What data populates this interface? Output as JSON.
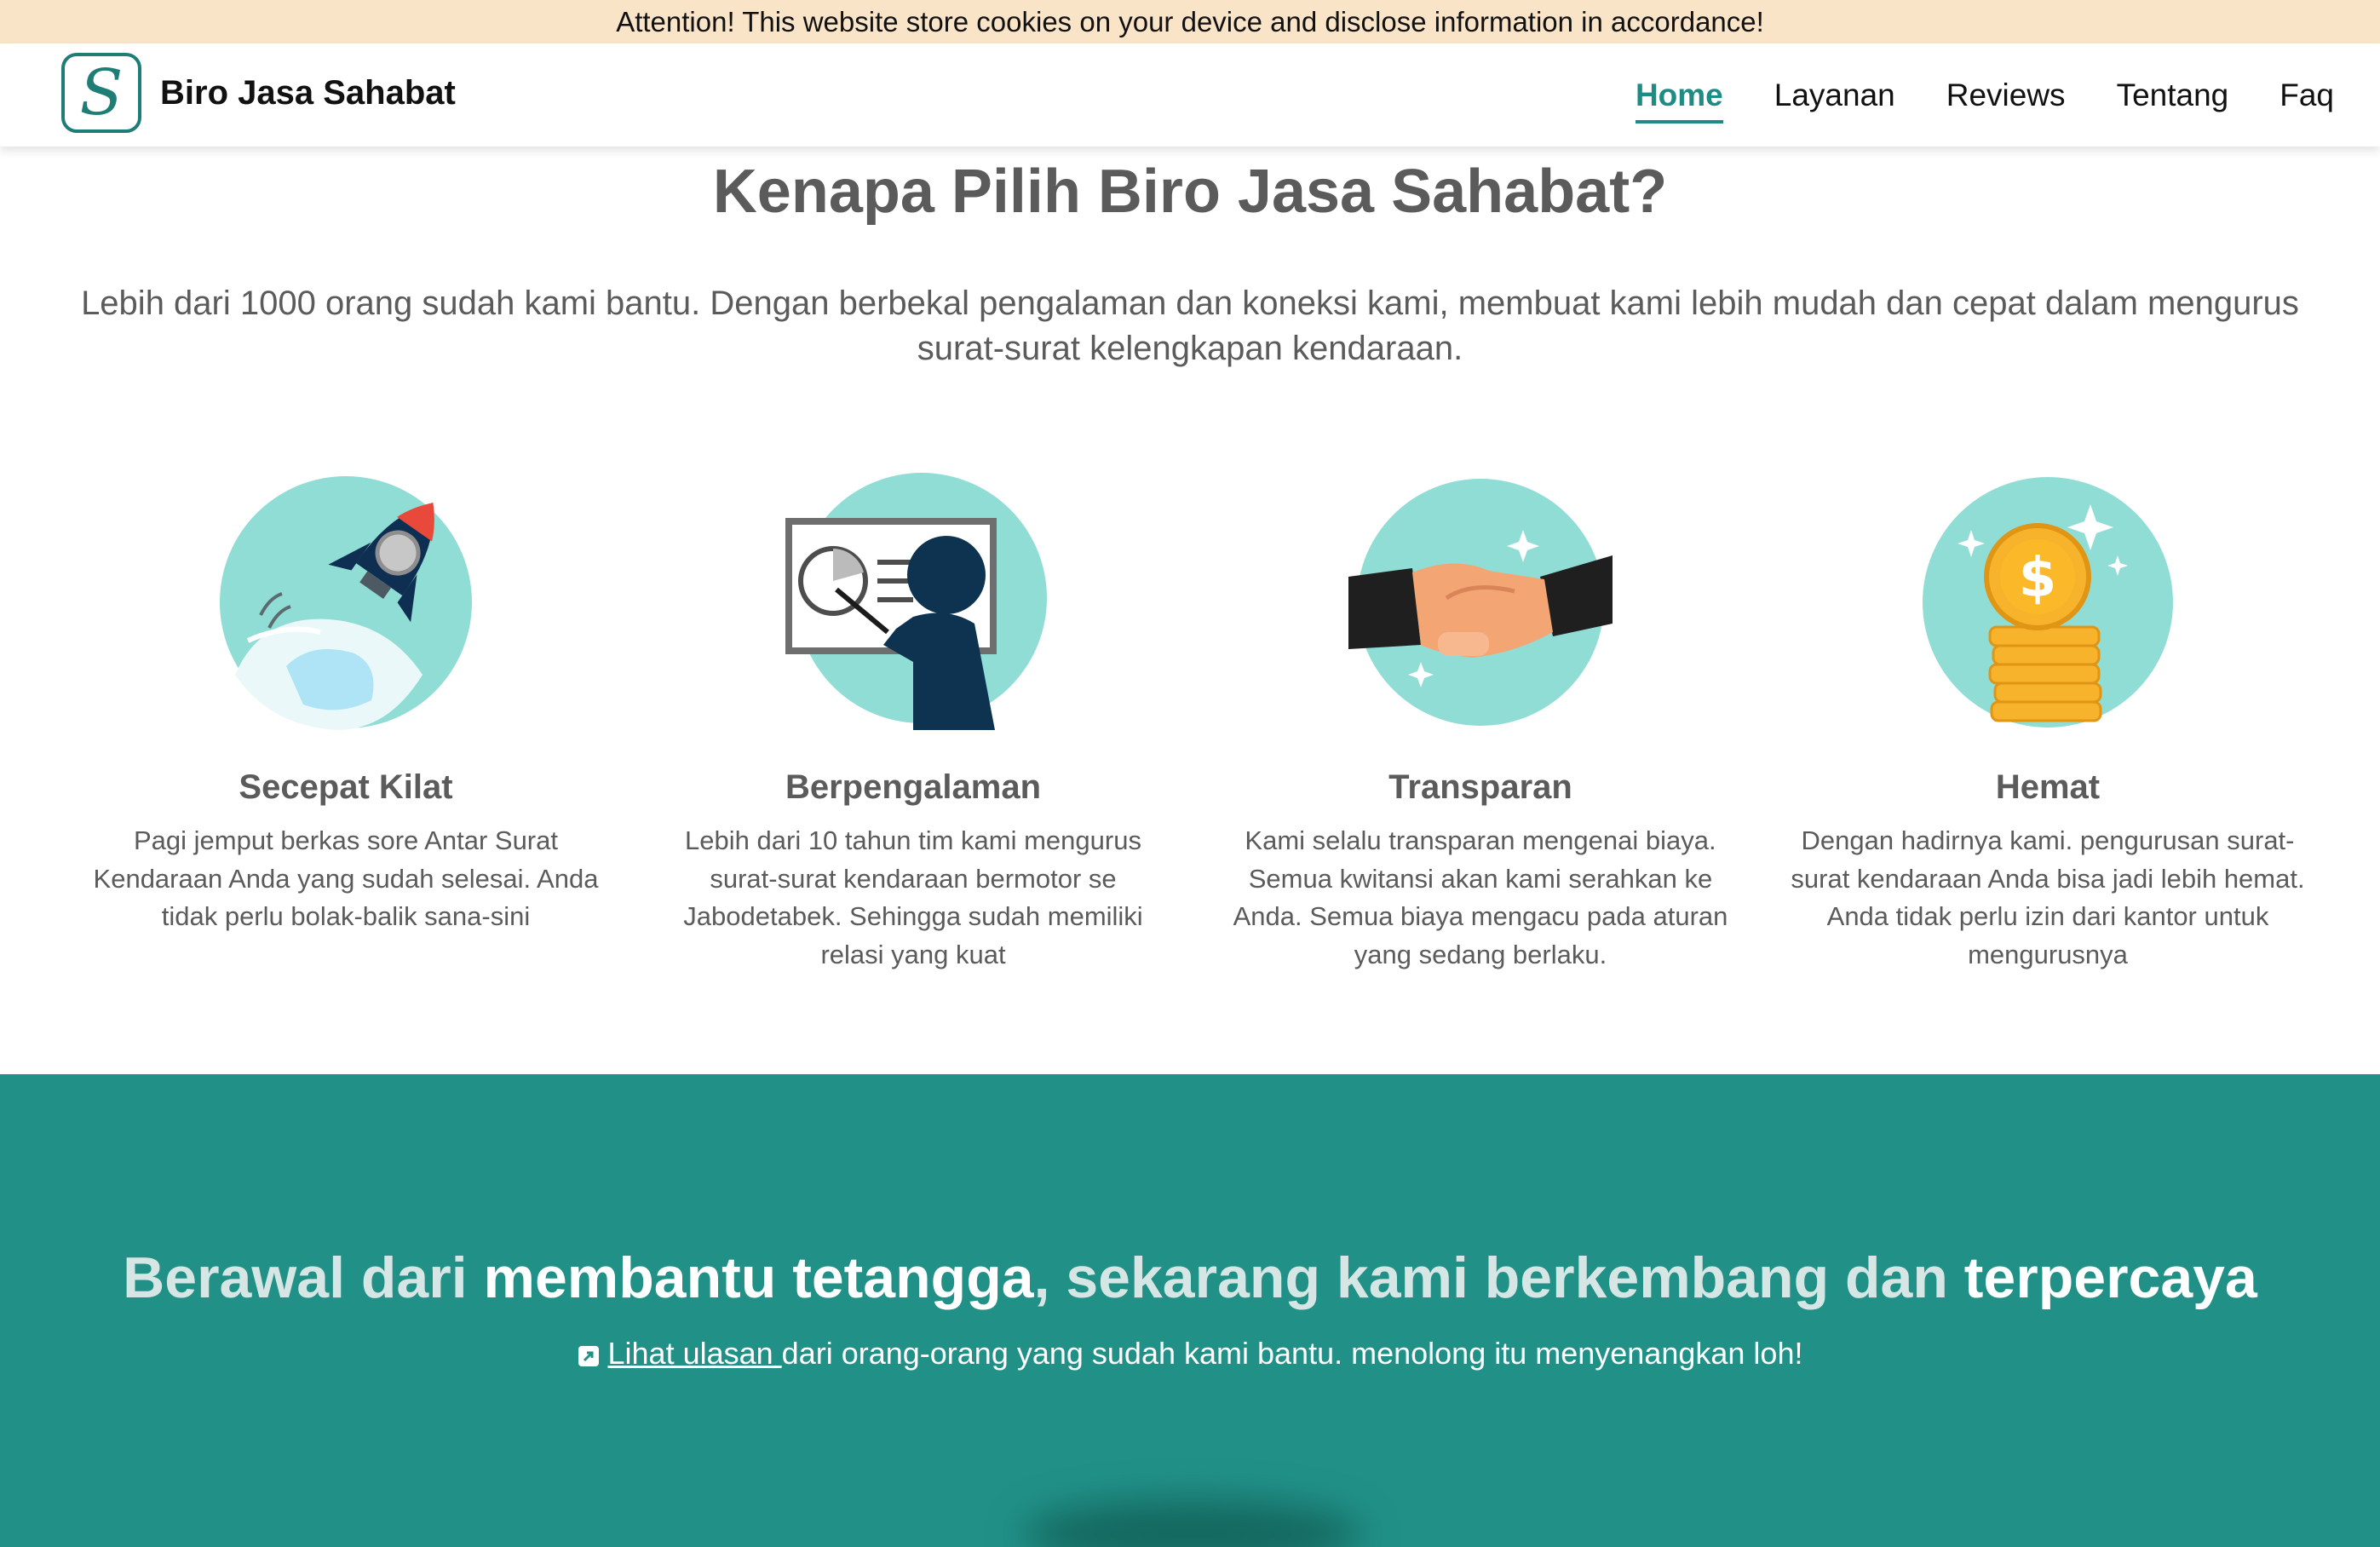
{
  "cookie_banner": {
    "text": "Attention! This website store cookies on your device and disclose information in accordance!"
  },
  "navbar": {
    "logo_letter": "S",
    "brand_name": "Biro Jasa Sahabat",
    "links": [
      {
        "label": "Home",
        "active": true
      },
      {
        "label": "Layanan",
        "active": false
      },
      {
        "label": "Reviews",
        "active": false
      },
      {
        "label": "Tentang",
        "active": false
      },
      {
        "label": "Faq",
        "active": false
      }
    ]
  },
  "why": {
    "title": "Kenapa Pilih Biro Jasa Sahabat?",
    "line1": "Lebih dari 1000 orang sudah kami bantu. Dengan berbekal pengalaman dan koneksi kami, membuat kami lebih mudah dan cepat dalam mengurus",
    "line2": "surat-surat kelengkapan kendaraan."
  },
  "features": [
    {
      "icon": "rocket-icon",
      "title": "Secepat Kilat",
      "lines": [
        "Pagi jemput berkas sore Antar Surat",
        "Kendaraan Anda yang sudah selesai. Anda",
        "tidak perlu bolak-balik sana-sini"
      ]
    },
    {
      "icon": "presentation-icon",
      "title": "Berpengalaman",
      "lines": [
        "Lebih dari 10 tahun tim kami mengurus",
        "surat-surat kendaraan bermotor se",
        "Jabodetabek. Sehingga sudah memiliki",
        "relasi yang kuat"
      ]
    },
    {
      "icon": "handshake-icon",
      "title": "Transparan",
      "lines": [
        "Kami selalu transparan mengenai biaya.",
        "Semua kwitansi akan kami serahkan ke",
        "Anda. Semua biaya mengacu pada aturan",
        "yang sedang berlaku."
      ]
    },
    {
      "icon": "coins-icon",
      "title": "Hemat",
      "lines": [
        "Dengan hadirnya kami. pengurusan surat-",
        "surat kendaraan Anda bisa jadi lebih hemat.",
        "Anda tidak perlu izin dari kantor untuk",
        "mengurusnya"
      ]
    }
  ],
  "cta": {
    "heading_parts": [
      "Berawal dari ",
      "membantu tetangga",
      ", sekarang kami berkembang dan ",
      "terpercaya"
    ],
    "link_text": "Lihat ulasan ",
    "sub_text": "dari orang-orang yang sudah kami bantu. menolong itu menyenangkan loh!"
  },
  "colors": {
    "accent": "#1e8c84",
    "cta_background": "#219188",
    "cookie_background": "#f9e4c8",
    "icon_circle": "#90ddd6"
  }
}
